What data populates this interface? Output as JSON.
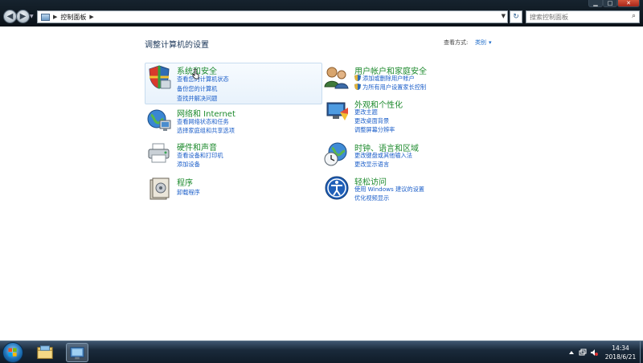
{
  "address_bar": {
    "breadcrumb": "控制面板",
    "search_placeholder": "搜索控制面板"
  },
  "content": {
    "title": "调整计算机的设置",
    "view_by_label": "查看方式:",
    "view_by_value": "类别"
  },
  "categories": [
    {
      "title": "系统和安全",
      "icon": "security-shield-icon",
      "links": [
        "查看您的计算机状态",
        "备份您的计算机",
        "查找并解决问题"
      ]
    },
    {
      "title": "网络和 Internet",
      "icon": "network-globe-icon",
      "links": [
        "查看网络状态和任务",
        "选择家庭组和共享选项"
      ]
    },
    {
      "title": "硬件和声音",
      "icon": "printer-icon",
      "links": [
        "查看设备和打印机",
        "添加设备"
      ]
    },
    {
      "title": "程序",
      "icon": "programs-icon",
      "links": [
        "卸载程序"
      ]
    },
    {
      "title": "用户帐户和家庭安全",
      "icon": "users-icon",
      "links": [
        "添加或删除用户帐户",
        "为所有用户设置家长控制"
      ]
    },
    {
      "title": "外观和个性化",
      "icon": "appearance-icon",
      "links": [
        "更改主题",
        "更改桌面背景",
        "调整屏幕分辨率"
      ]
    },
    {
      "title": "时钟、语言和区域",
      "icon": "clock-globe-icon",
      "links": [
        "更改键盘或其他输入法",
        "更改显示语言"
      ]
    },
    {
      "title": "轻松访问",
      "icon": "ease-of-access-icon",
      "links": [
        "使用 Windows 建议的设置",
        "优化视频显示"
      ]
    }
  ],
  "taskbar": {
    "time": "14:34",
    "date": "2018/6/21"
  },
  "colors": {
    "category_title": "#1d8a2d",
    "link": "#1b5ec9",
    "page_title": "#1e395b"
  }
}
